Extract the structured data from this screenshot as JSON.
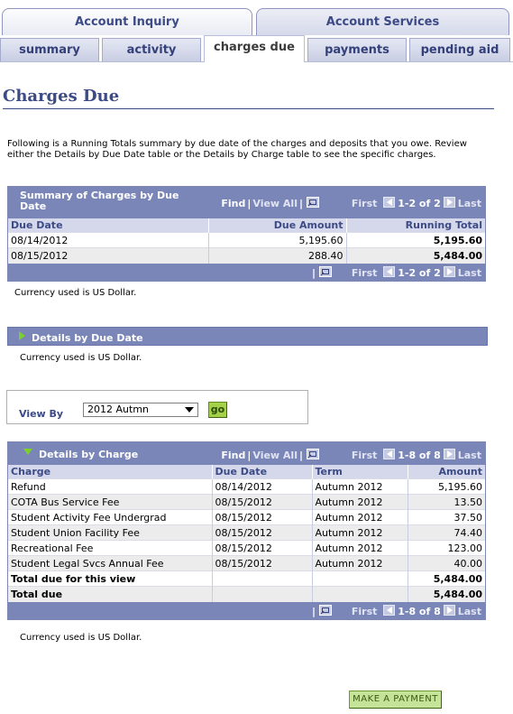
{
  "tabs_top": [
    {
      "label": "Account Inquiry",
      "active": true
    },
    {
      "label": "Account Services",
      "active": false
    }
  ],
  "subtabs": [
    {
      "label": "summary",
      "active": false
    },
    {
      "label": "activity",
      "active": false
    },
    {
      "label": "charges due",
      "active": true
    },
    {
      "label": "payments",
      "active": false
    },
    {
      "label": "pending aid",
      "active": false
    }
  ],
  "page_title": "Charges Due",
  "intro": "Following is a Running Totals summary by due date of the charges and deposits that you owe. Review either the Details by Due Date table or the Details by Charge table to see the specific charges.",
  "nav": {
    "find": "Find",
    "view_all": "View All",
    "first": "First",
    "last": "Last",
    "sep": "|"
  },
  "summary_grid": {
    "title": "Summary of Charges by Due Date",
    "range": "1-2 of 2",
    "columns": [
      "Due Date",
      "Due Amount",
      "Running Total"
    ],
    "rows": [
      {
        "due_date": "08/14/2012",
        "due_amount": "5,195.60",
        "running_total": "5,195.60"
      },
      {
        "due_date": "08/15/2012",
        "due_amount": "288.40",
        "running_total": "5,484.00"
      }
    ]
  },
  "currency_note": "Currency used is US Dollar.",
  "details_by_due_date": {
    "title": "Details by Due Date"
  },
  "view_by": {
    "label": "View By",
    "selected": "2012 Autmn",
    "go": "go"
  },
  "charge_grid": {
    "title": "Details by Charge",
    "range": "1-8 of 8",
    "columns": [
      "Charge",
      "Due Date",
      "Term",
      "Amount"
    ],
    "rows": [
      {
        "charge": "Refund",
        "due_date": "08/14/2012",
        "term": "Autumn 2012",
        "amount": "5,195.60"
      },
      {
        "charge": "COTA Bus Service Fee",
        "due_date": "08/15/2012",
        "term": "Autumn 2012",
        "amount": "13.50"
      },
      {
        "charge": "Student Activity Fee Undergrad",
        "due_date": "08/15/2012",
        "term": "Autumn 2012",
        "amount": "37.50"
      },
      {
        "charge": "Student Union Facility Fee",
        "due_date": "08/15/2012",
        "term": "Autumn 2012",
        "amount": "74.40"
      },
      {
        "charge": "Recreational Fee",
        "due_date": "08/15/2012",
        "term": "Autumn 2012",
        "amount": "123.00"
      },
      {
        "charge": "Student Legal Svcs Annual Fee",
        "due_date": "08/15/2012",
        "term": "Autumn 2012",
        "amount": "40.00"
      }
    ],
    "total_view_label": "Total due for this view",
    "total_view_amount": "5,484.00",
    "total_label": "Total due",
    "total_amount": "5,484.00"
  },
  "make_payment": "Make A Payment",
  "colors": {
    "accent": "#3c4a86",
    "grid_header": "#7a86b8",
    "button_green": "#a4d04a"
  }
}
